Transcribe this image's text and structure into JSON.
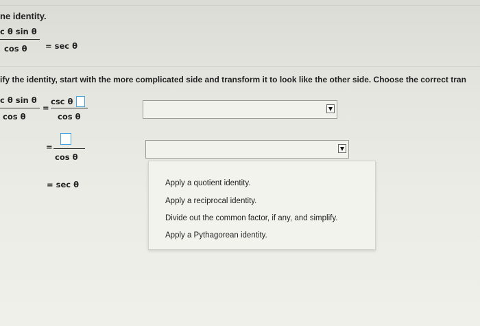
{
  "header": {
    "title": "ne identity."
  },
  "problem": {
    "lhs_num": "c θ sin θ",
    "lhs_den": "cos θ",
    "equals_rhs": "= sec θ"
  },
  "instruction": "ify the identity, start with the more complicated side and transform it to look like the other side. Choose the correct tran",
  "steps": {
    "step1": {
      "lhs_num": "c θ sin θ",
      "lhs_den": "cos θ",
      "eq": "=",
      "rhs_num": "csc θ",
      "rhs_den": "cos θ"
    },
    "step2": {
      "eq": "=",
      "den": "cos θ"
    },
    "step3": {
      "text": "= sec θ"
    }
  },
  "dropdown": {
    "options": [
      "Apply a quotient identity.",
      "Apply a reciprocal identity.",
      "Divide out the common factor, if any, and simplify.",
      "Apply a Pythagorean identity."
    ]
  }
}
